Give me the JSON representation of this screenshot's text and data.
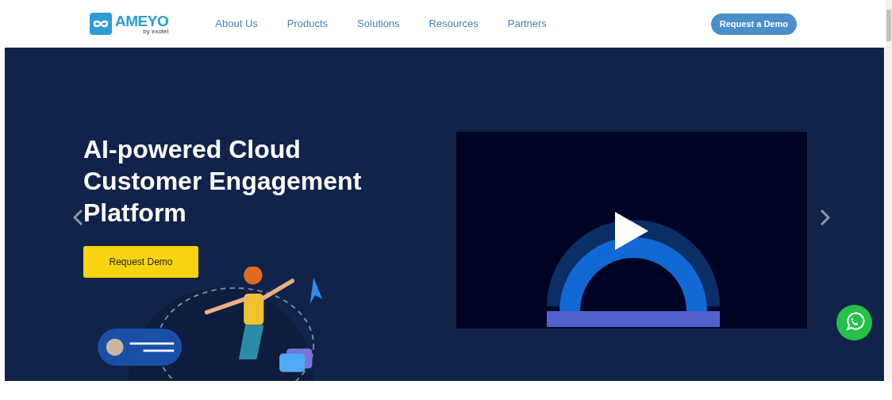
{
  "header": {
    "logo": {
      "name": "AMEYO",
      "tagline": "by exotel"
    },
    "nav": [
      {
        "label": "About Us"
      },
      {
        "label": "Products"
      },
      {
        "label": "Solutions"
      },
      {
        "label": "Resources"
      },
      {
        "label": "Partners"
      }
    ],
    "cta": "Request a Demo"
  },
  "hero": {
    "title": "AI-powered Cloud Customer Engagement Platform",
    "button": "Request Demo"
  }
}
